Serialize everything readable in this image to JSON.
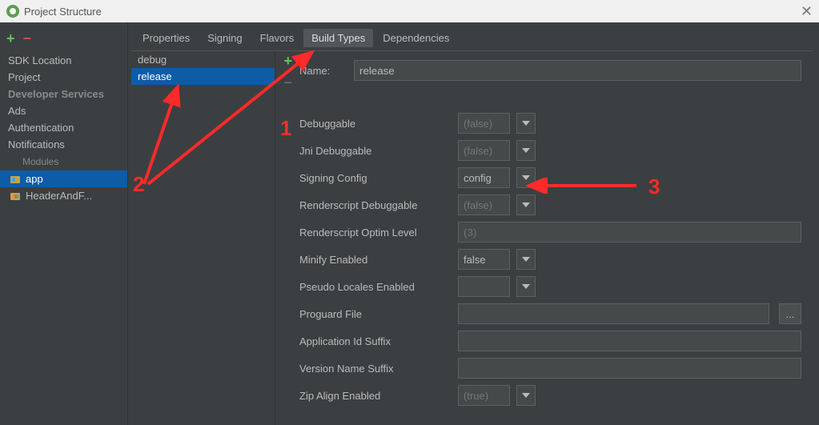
{
  "window": {
    "title": "Project Structure",
    "close": "✕"
  },
  "left": {
    "items": [
      "SDK Location",
      "Project"
    ],
    "dev_services_label": "Developer Services",
    "dev_services": [
      "Ads",
      "Authentication",
      "Notifications"
    ],
    "modules_label": "Modules",
    "modules": [
      {
        "name": "app",
        "selected": true
      },
      {
        "name": "HeaderAndF..."
      }
    ]
  },
  "tabs": {
    "items": [
      "Properties",
      "Signing",
      "Flavors",
      "Build Types",
      "Dependencies"
    ],
    "selected": "Build Types"
  },
  "build_types": {
    "items": [
      "debug",
      "release"
    ],
    "selected": "release"
  },
  "form": {
    "name_label": "Name:",
    "name_value": "release",
    "rows": [
      {
        "label": "Debuggable",
        "value": "(false)",
        "placeholder": true
      },
      {
        "label": "Jni Debuggable",
        "value": "(false)",
        "placeholder": true
      },
      {
        "label": "Signing Config",
        "value": "config",
        "placeholder": false
      },
      {
        "label": "Renderscript Debuggable",
        "value": "(false)",
        "placeholder": true
      },
      {
        "label": "Renderscript Optim Level",
        "value": "(3)",
        "text_input": true,
        "placeholder": true
      },
      {
        "label": "Minify Enabled",
        "value": "false",
        "placeholder": false
      },
      {
        "label": "Pseudo Locales Enabled",
        "value": "",
        "placeholder": true
      },
      {
        "label": "Proguard File",
        "value": "",
        "text_input": true,
        "browse": true
      },
      {
        "label": "Application Id Suffix",
        "value": "",
        "text_input": true
      },
      {
        "label": "Version Name Suffix",
        "value": "",
        "text_input": true
      },
      {
        "label": "Zip Align Enabled",
        "value": "(true)",
        "placeholder": true
      }
    ]
  },
  "annotations": {
    "one": "1",
    "two": "2",
    "three": "3"
  }
}
